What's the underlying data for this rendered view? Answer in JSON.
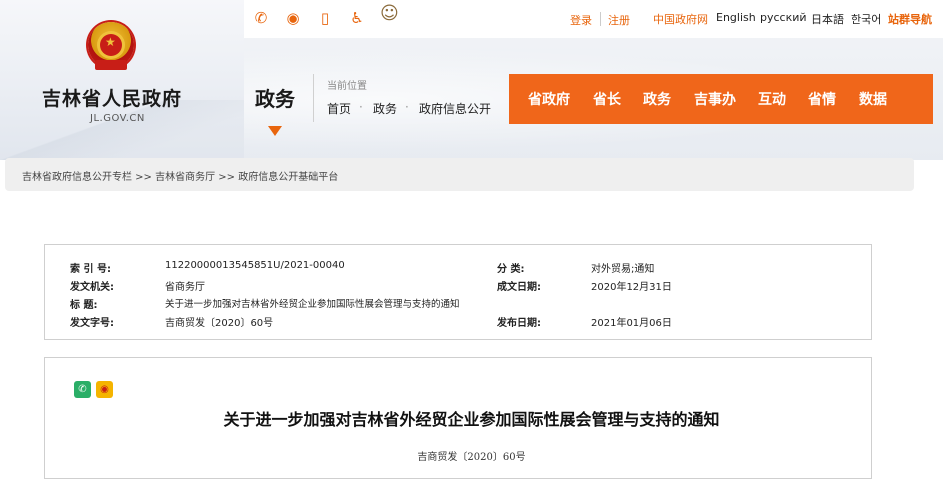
{
  "header": {
    "site_name": "吉林省人民政府",
    "site_domain": "JL.GOV.CN",
    "login": "登录",
    "register": "注册",
    "languages": [
      "中国政府网",
      "English",
      "русский",
      "日本語",
      "한국어",
      "站群导航"
    ],
    "share_icons": [
      "wechat-icon",
      "weibo-icon",
      "mobile-icon",
      "accessibility-icon",
      "mascot-icon"
    ]
  },
  "section": {
    "title": "政务",
    "location_label": "当前位置",
    "breadcrumb": [
      "首页",
      "政务",
      "政府信息公开"
    ]
  },
  "nav": {
    "items": [
      "省政府",
      "省长",
      "政务",
      "吉事办",
      "互动",
      "省情",
      "数据"
    ]
  },
  "path_bar": {
    "text": "吉林省政府信息公开专栏 >> 吉林省商务厅 >> 政府信息公开基础平台"
  },
  "meta": {
    "index_label": "索 引 号:",
    "index_value": "11220000013545851U/2021-00040",
    "category_label": "分    类:",
    "category_value": "对外贸易;通知",
    "issuer_label": "发文机关:",
    "issuer_value": "省商务厅",
    "created_label": "成文日期:",
    "created_value": "2020年12月31日",
    "title_label": "标     题:",
    "title_value": "关于进一步加强对吉林省外经贸企业参加国际性展会管理与支持的通知",
    "doc_no_label": "发文字号:",
    "doc_no_value": "吉商贸发〔2020〕60号",
    "published_label": "发布日期:",
    "published_value": "2021年01月06日"
  },
  "article": {
    "title": "关于进一步加强对吉林省外经贸企业参加国际性展会管理与支持的通知",
    "doc_no": "吉商贸发〔2020〕60号"
  },
  "colors": {
    "accent": "#f0661a",
    "link_orange": "#e8650d"
  }
}
